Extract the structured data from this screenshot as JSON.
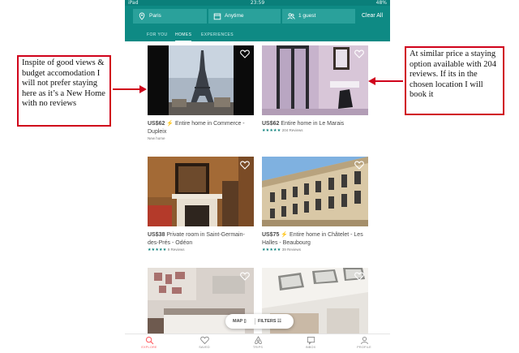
{
  "status_bar": {
    "device": "iPad",
    "time": "23:59",
    "battery": "48%"
  },
  "search": {
    "location": "Paris",
    "dates": "Anytime",
    "guests": "1 guest",
    "clear_label": "Clear All"
  },
  "tabs": [
    {
      "label": "FOR YOU",
      "active": false
    },
    {
      "label": "HOMES",
      "active": true
    },
    {
      "label": "EXPERIENCES",
      "active": false
    }
  ],
  "listings": [
    {
      "price": "US$62",
      "instant": "⚡",
      "description": "Entire home in Commerce - Dupleix",
      "rating_stars": "",
      "reviews": "New home"
    },
    {
      "price": "US$62",
      "instant": "",
      "description": "Entire home in Le Marais",
      "rating_stars": "★★★★★",
      "reviews": "204 Reviews"
    },
    {
      "price": "US$38",
      "instant": "",
      "description": "Private room in Saint-Germain-des-Prés - Odéon",
      "rating_stars": "★★★★★",
      "reviews": "9 Reviews"
    },
    {
      "price": "US$75",
      "instant": "⚡",
      "description": "Entire home in Châtelet - Les Halles - Beaubourg",
      "rating_stars": "★★★★★",
      "reviews": "39 Reviews"
    },
    {
      "price": "",
      "instant": "",
      "description": "",
      "rating_stars": "",
      "reviews": ""
    },
    {
      "price": "",
      "instant": "",
      "description": "",
      "rating_stars": "",
      "reviews": ""
    }
  ],
  "map_pill": {
    "map_label": "MAP",
    "filters_label": "FILTERS"
  },
  "bottom_nav": [
    {
      "label": "EXPLORE",
      "icon": "search-icon",
      "active": true
    },
    {
      "label": "SAVED",
      "icon": "heart-icon",
      "active": false
    },
    {
      "label": "TRIPS",
      "icon": "airbnb-logo-icon",
      "active": false
    },
    {
      "label": "INBOX",
      "icon": "chat-icon",
      "active": false
    },
    {
      "label": "PROFILE",
      "icon": "person-icon",
      "active": false
    }
  ],
  "annotations": {
    "left": "Inspite of good views & budget accomodation I will not prefer staying here as it’s a New Home with no reviews",
    "right": "At similar price a staying option available with 204 reviews. If its in the chosen location I will book it"
  },
  "colors": {
    "header": "#0e8a84",
    "search_segment": "#2aa19b",
    "accent_active_nav": "#ff5a5f",
    "annotation_border": "#d0021b",
    "star": "#0a7f7a"
  }
}
